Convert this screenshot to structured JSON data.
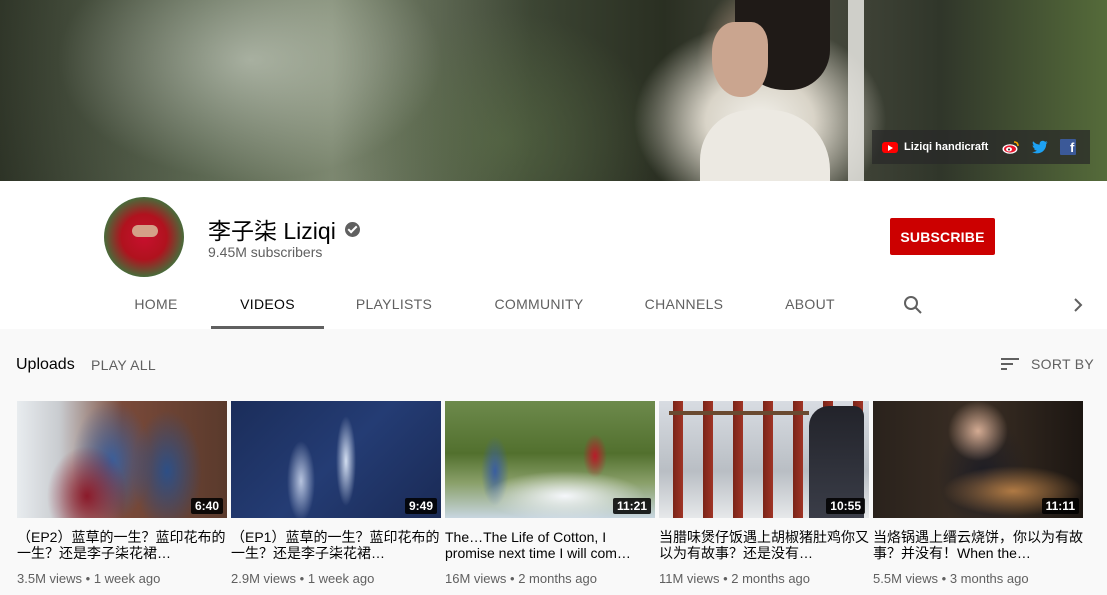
{
  "banner": {
    "link_label": "Liziqi handicraft",
    "icons": [
      "youtube-icon",
      "weibo-icon",
      "twitter-icon",
      "facebook-icon"
    ]
  },
  "channel": {
    "name": "李子柒 Liziqi",
    "subscribers": "9.45M subscribers",
    "subscribe_label": "SUBSCRIBE"
  },
  "tabs": [
    {
      "label": "HOME",
      "active": false
    },
    {
      "label": "VIDEOS",
      "active": true
    },
    {
      "label": "PLAYLISTS",
      "active": false
    },
    {
      "label": "COMMUNITY",
      "active": false
    },
    {
      "label": "CHANNELS",
      "active": false
    },
    {
      "label": "ABOUT",
      "active": false
    }
  ],
  "section": {
    "title": "Uploads",
    "play_all": "PLAY ALL",
    "sort_by": "SORT BY"
  },
  "videos": [
    {
      "duration": "6:40",
      "title": "（EP2）蓝草的一生？蓝印花布的一生？还是李子柒花裙…",
      "views": "3.5M views",
      "age": "1 week ago"
    },
    {
      "duration": "9:49",
      "title": "（EP1）蓝草的一生？蓝印花布的一生？还是李子柒花裙…",
      "views": "2.9M views",
      "age": "1 week ago"
    },
    {
      "duration": "11:21",
      "title": "The…The Life of Cotton, I promise next time I will com…",
      "views": "16M views",
      "age": "2 months ago"
    },
    {
      "duration": "10:55",
      "title": "当腊味煲仔饭遇上胡椒猪肚鸡你又以为有故事？还是没有…",
      "views": "11M views",
      "age": "2 months ago"
    },
    {
      "duration": "11:11",
      "title": "当烙锅遇上缙云烧饼，你以为有故事？并没有！When the…",
      "views": "5.5M views",
      "age": "3 months ago"
    }
  ],
  "colors": {
    "subscribe_red": "#cc0000",
    "text_primary": "#030303",
    "text_secondary": "#606060",
    "page_bg": "#f9f9f9"
  }
}
